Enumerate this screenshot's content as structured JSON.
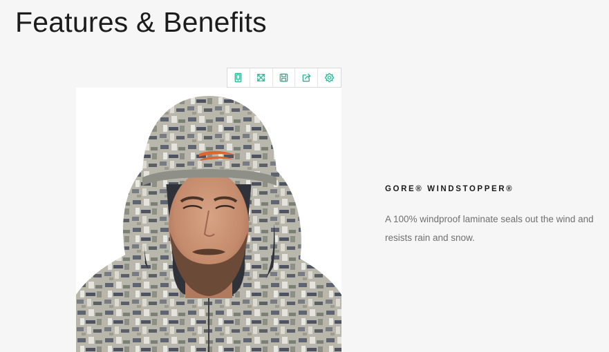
{
  "section": {
    "title": "Features & Benefits"
  },
  "toolbar": {
    "accent_color": "#2db394",
    "icons": [
      "tablet-icon",
      "expand-icon",
      "save-icon",
      "share-icon",
      "settings-gear-icon"
    ]
  },
  "image": {
    "subject": "product-photo"
  },
  "feature": {
    "title": "GORE® WINDSTOPPER®",
    "description": "A 100% windproof laminate seals out the wind and resists rain and snow."
  }
}
